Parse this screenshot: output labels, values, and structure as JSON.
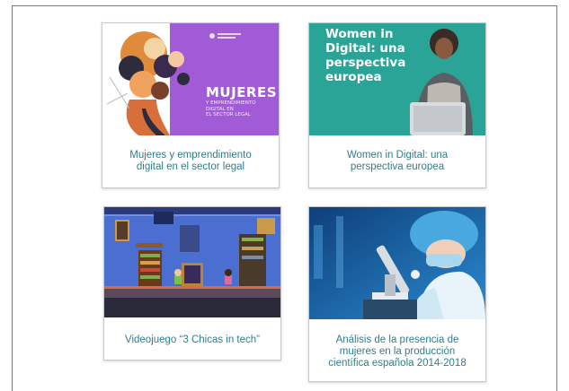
{
  "cards": [
    {
      "caption_line1": "Mujeres y emprendimiento",
      "caption_line2": "digital en el sector legal",
      "thumb_title": "MUJERES",
      "thumb_sub1": "Y EMPRENDIMIENTO",
      "thumb_sub2": "DIGITAL EN",
      "thumb_sub3": "EL SECTOR LEGAL",
      "accent": "#a25bd7"
    },
    {
      "caption_line1": "Women in Digital: una",
      "caption_line2": "perspectiva europea",
      "thumb_line1": "Women in",
      "thumb_line2": "Digital: una",
      "thumb_line3": "perspectiva",
      "thumb_line4": "europea",
      "accent": "#2aa496"
    },
    {
      "caption_line1": "Videojuego “3 Chicas in tech”",
      "accent": "#4a6fd0"
    },
    {
      "caption_line1": "Análisis de la presencia de",
      "caption_line2": "mujeres en la producción",
      "caption_line3": "científica española 2014-2018",
      "accent": "#1a6fb0"
    }
  ],
  "colors": {
    "caption_text": "#2f7f8a",
    "frame_border": "#7a7a7a"
  }
}
